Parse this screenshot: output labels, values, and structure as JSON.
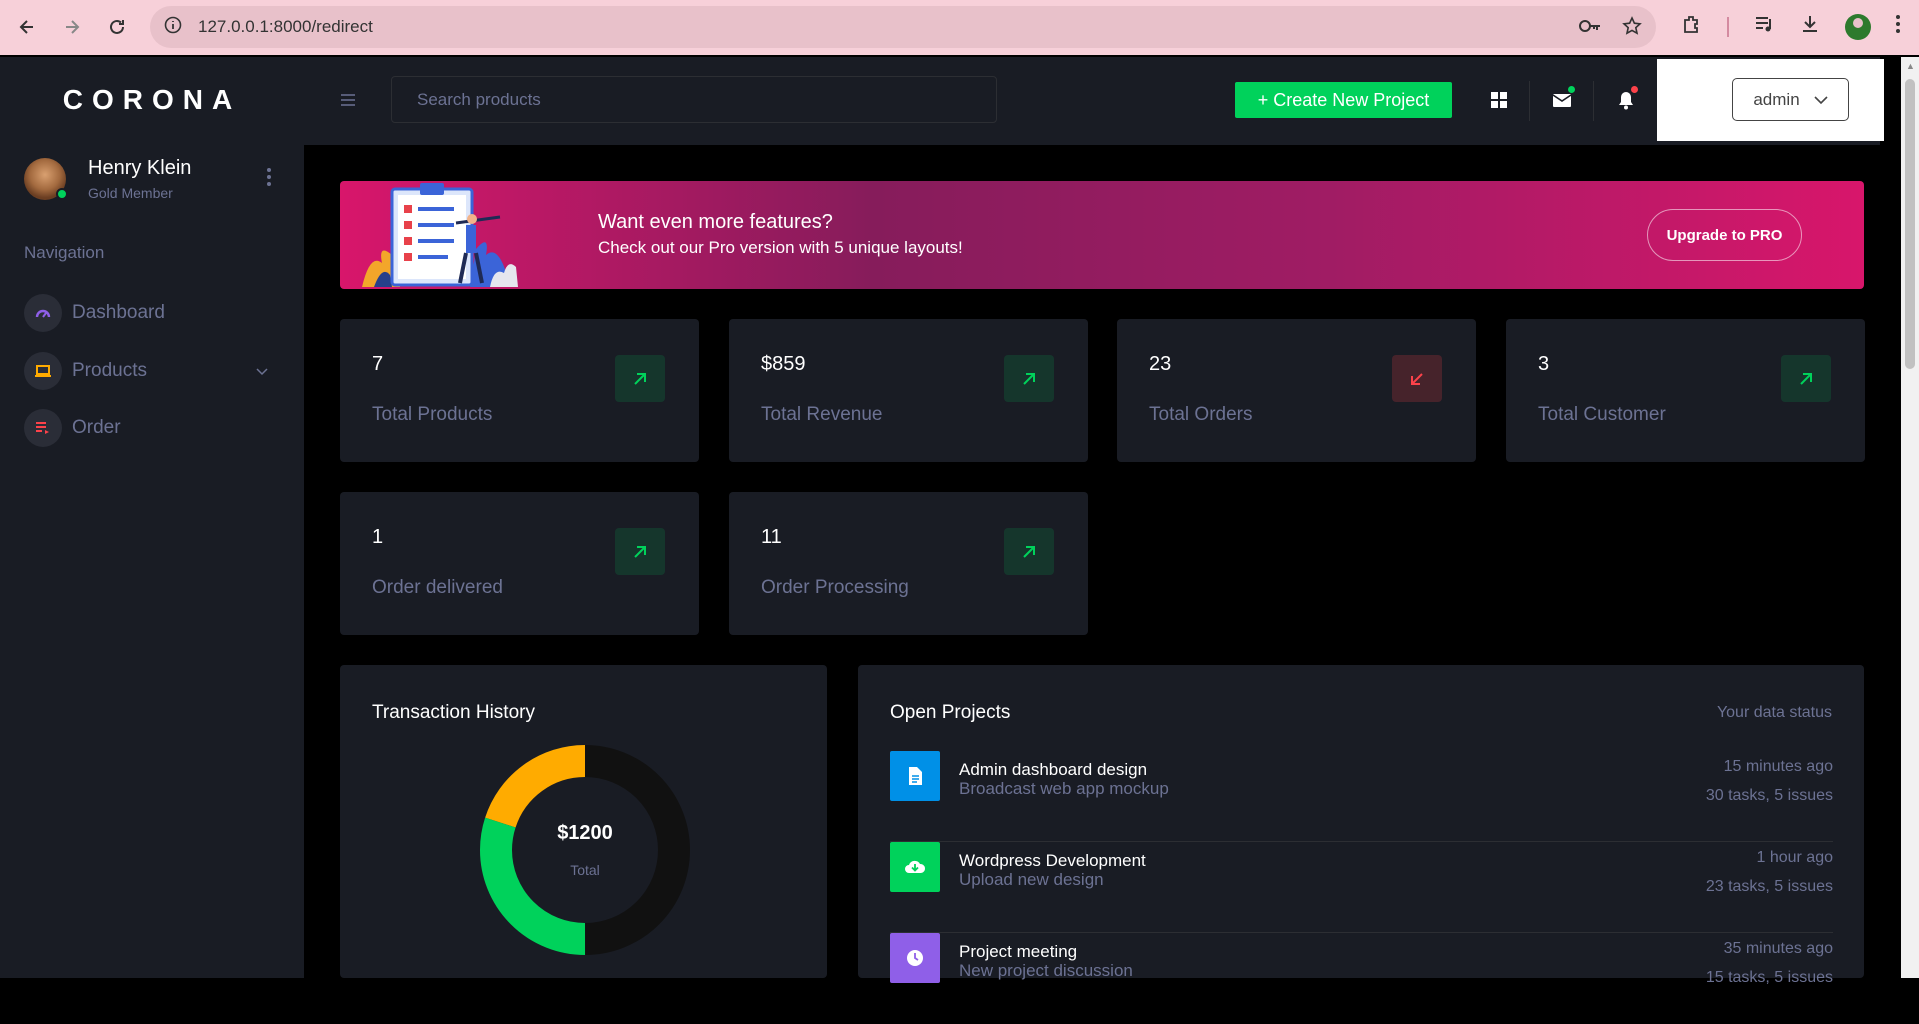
{
  "browser": {
    "url": "127.0.0.1:8000/redirect"
  },
  "sidebar": {
    "brand": "CORONA",
    "profile": {
      "name": "Henry Klein",
      "role": "Gold Member"
    },
    "nav_caption": "Navigation",
    "items": [
      {
        "label": "Dashboard",
        "icon": "speedometer-icon",
        "color": "#8f5fe8"
      },
      {
        "label": "Products",
        "icon": "laptop-icon",
        "color": "#ffab00",
        "expandable": true
      },
      {
        "label": "Order",
        "icon": "playlist-icon",
        "color": "#fc424a"
      }
    ]
  },
  "topbar": {
    "search_placeholder": "Search products",
    "create_label": "+ Create New Project",
    "user_label": "admin"
  },
  "banner": {
    "title": "Want even more features?",
    "subtitle": "Check out our Pro version with 5 unique layouts!",
    "button": "Upgrade to PRO"
  },
  "stats": [
    {
      "value": "7",
      "label": "Total Products",
      "trend": "up"
    },
    {
      "value": "$859",
      "label": "Total Revenue",
      "trend": "up"
    },
    {
      "value": "23",
      "label": "Total Orders",
      "trend": "down"
    },
    {
      "value": "3",
      "label": "Total Customer",
      "trend": "up"
    },
    {
      "value": "1",
      "label": "Order delivered",
      "trend": "up"
    },
    {
      "value": "11",
      "label": "Order Processing",
      "trend": "up"
    }
  ],
  "transaction": {
    "title": "Transaction History",
    "amount": "$1200",
    "total_label": "Total",
    "segments": [
      {
        "color": "#ffab00",
        "fraction": 0.2
      },
      {
        "color": "#00d25b",
        "fraction": 0.3
      },
      {
        "color": "#111111",
        "fraction": 0.5
      }
    ]
  },
  "projects": {
    "title": "Open Projects",
    "status": "Your data status",
    "items": [
      {
        "title": "Admin dashboard design",
        "subtitle": "Broadcast web app mockup",
        "time": "15 minutes ago",
        "tasks": "30 tasks, 5 issues",
        "icon": "file-icon",
        "color": "#0090e7"
      },
      {
        "title": "Wordpress Development",
        "subtitle": "Upload new design",
        "time": "1 hour ago",
        "tasks": "23 tasks, 5 issues",
        "icon": "cloud-download-icon",
        "color": "#00d25b"
      },
      {
        "title": "Project meeting",
        "subtitle": "New project discussion",
        "time": "35 minutes ago",
        "tasks": "15 tasks, 5 issues",
        "icon": "clock-icon",
        "color": "#8f5fe8"
      }
    ]
  },
  "colors": {
    "success": "#00d25b",
    "danger": "#fc424a",
    "warning": "#ffab00",
    "primary": "#0090e7",
    "muted": "#6c7293",
    "card_bg": "#191c24"
  }
}
